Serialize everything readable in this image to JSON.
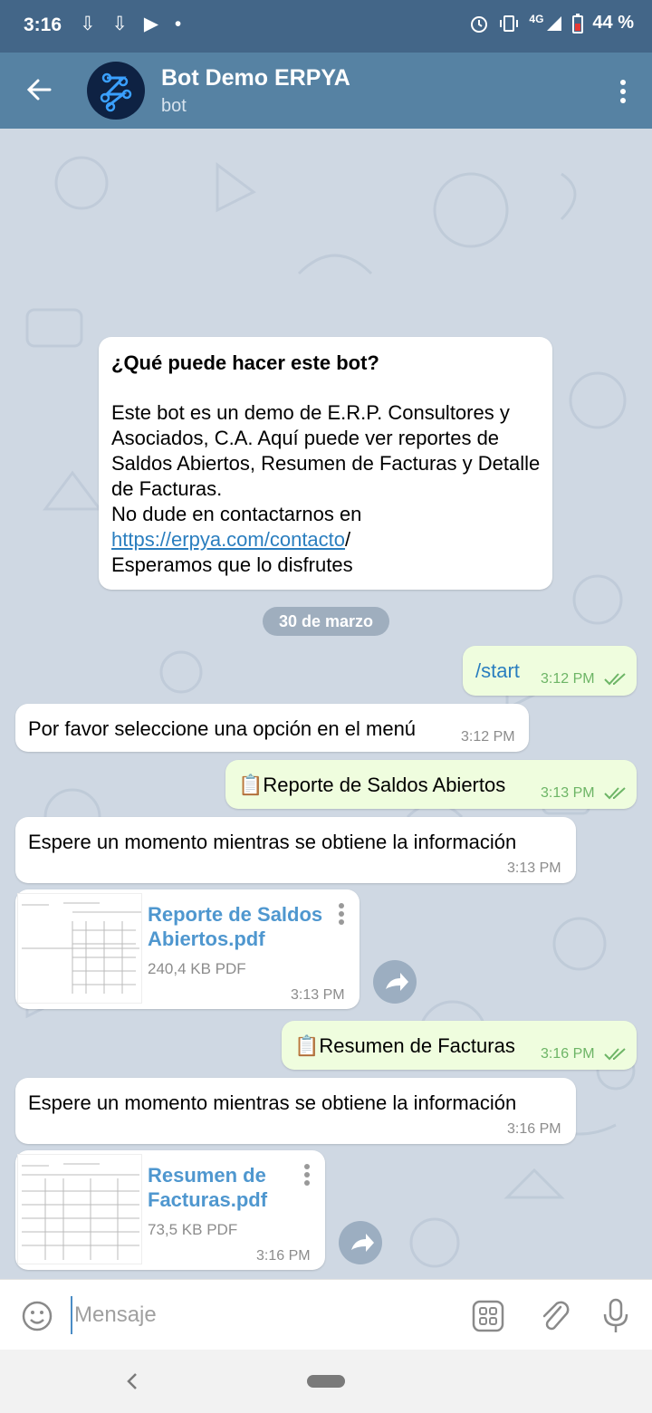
{
  "status": {
    "time": "3:16",
    "network": "4G",
    "battery": "44 %",
    "left_icons": "⇩ ⇩ ▶ •"
  },
  "header": {
    "title": "Bot Demo ERPYA",
    "subtitle": "bot"
  },
  "intro": {
    "heading": "¿Qué puede hacer este bot?",
    "line1": "Este bot es un demo de E.R.P. Consultores y Asociados, C.A. Aquí puede ver reportes de Saldos Abiertos, Resumen de Facturas y Detalle de Facturas.",
    "line2": "No dude en contactarnos en",
    "link": "https://erpya.com/contacto",
    "link_suffix": "/",
    "line3": "Esperamos que lo disfrutes"
  },
  "date_chip": "30 de marzo",
  "messages": [
    {
      "text": "/start",
      "time": "3:12 PM"
    },
    {
      "text": "Por favor seleccione una opción en el menú",
      "time": "3:12 PM"
    },
    {
      "text": "📋Reporte de Saldos Abiertos",
      "time": "3:13 PM"
    },
    {
      "text": "Espere un momento mientras se obtiene la información",
      "time": "3:13 PM"
    },
    {
      "file_line1": "Reporte de Saldos",
      "file_line2": "Abiertos.pdf",
      "size": "240,4 KB PDF",
      "time": "3:13 PM"
    },
    {
      "text": "📋Resumen de Facturas",
      "time": "3:16 PM"
    },
    {
      "text": "Espere un momento mientras se obtiene la información",
      "time": "3:16 PM"
    },
    {
      "file_line1": "Resumen de",
      "file_line2": "Facturas.pdf",
      "size": "73,5 KB PDF",
      "time": "3:16 PM"
    }
  ],
  "composer": {
    "placeholder": "Mensaje"
  },
  "colors": {
    "header": "#5682a3",
    "statusbar": "#436688",
    "chat_bg": "#cfd8e3",
    "outgoing": "#effdde",
    "link": "#4f97cf",
    "check": "#6db566"
  }
}
